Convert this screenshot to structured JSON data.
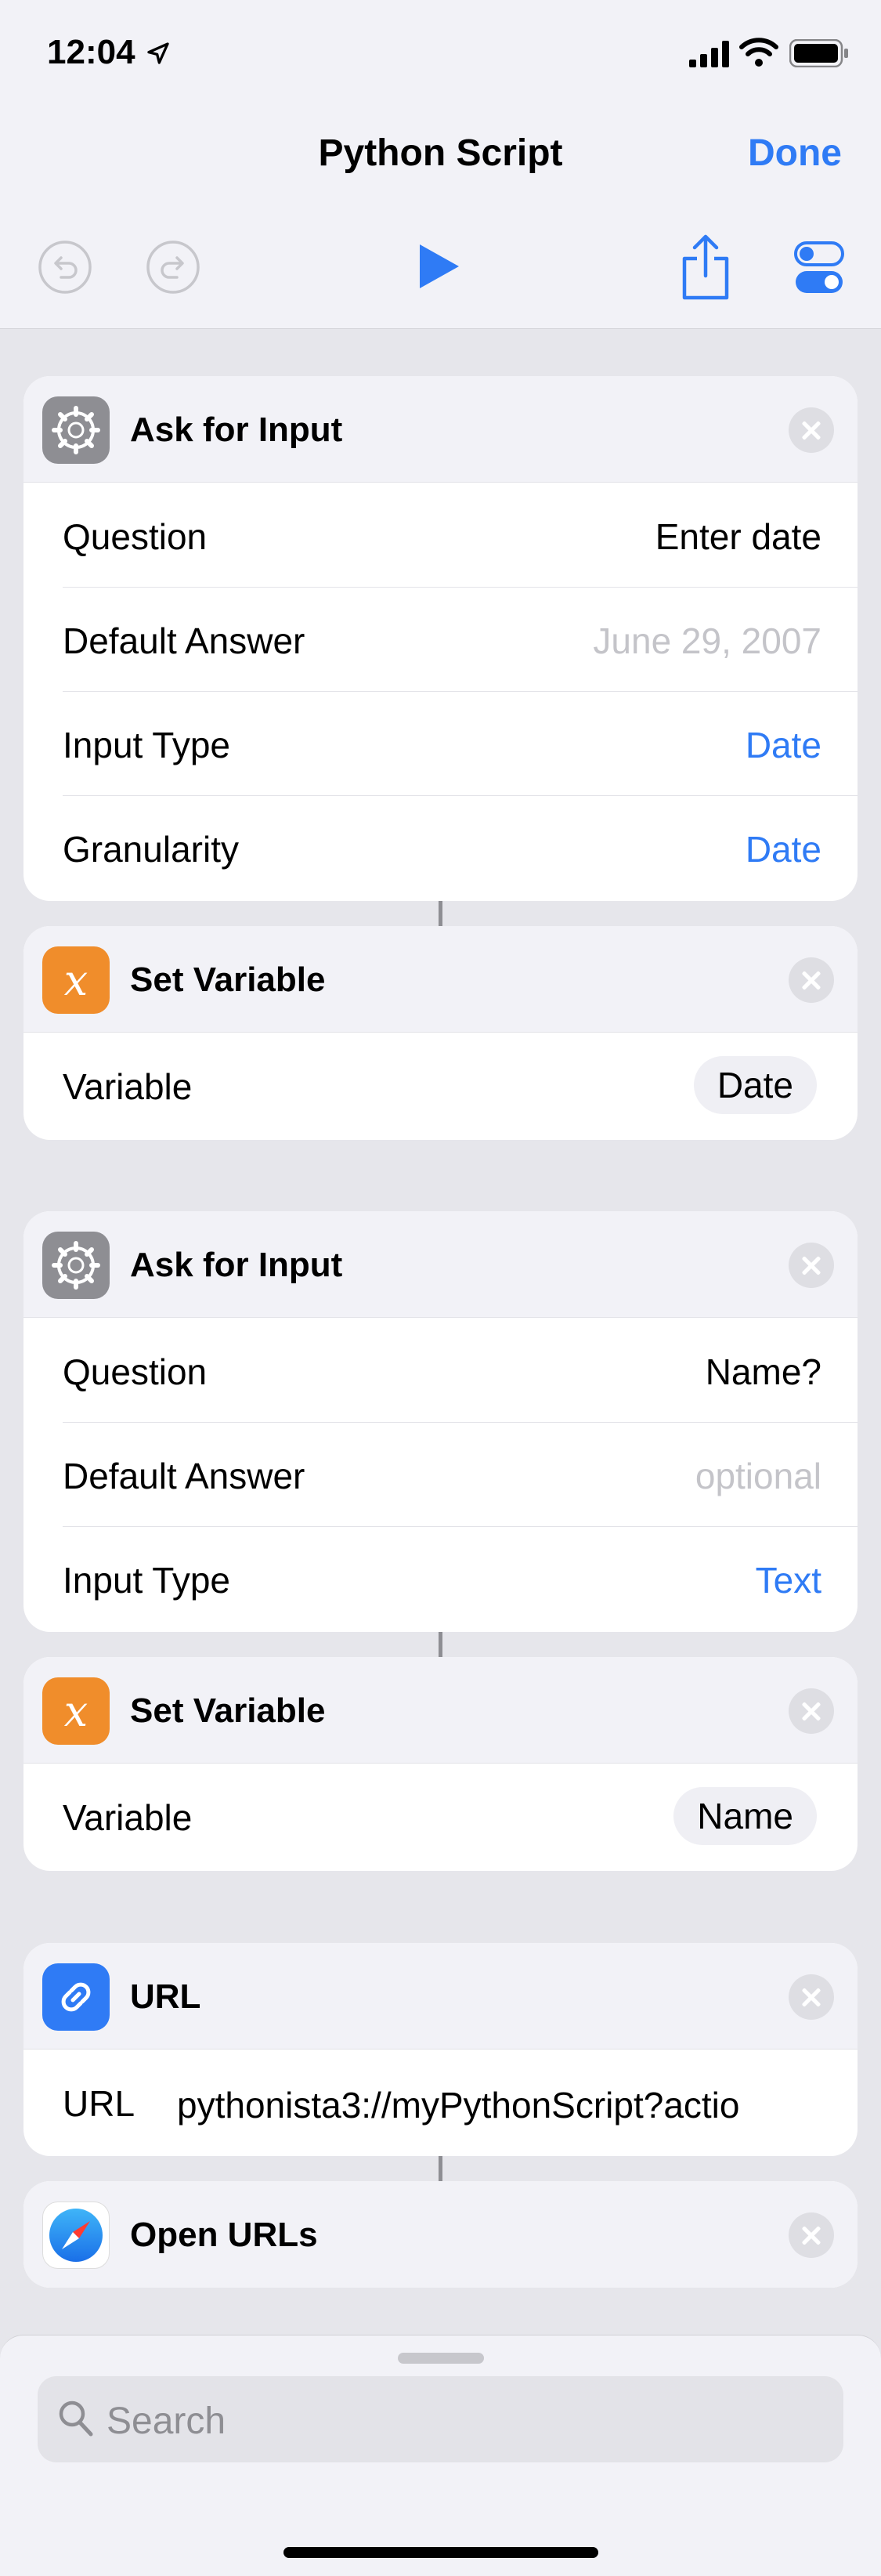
{
  "status_bar": {
    "time": "12:04"
  },
  "nav": {
    "title": "Python Script",
    "done_label": "Done"
  },
  "actions": {
    "ask1": {
      "title": "Ask for Input",
      "rows": [
        {
          "label": "Question",
          "value": "Enter date"
        },
        {
          "label": "Default Answer",
          "value": "June 29, 2007"
        },
        {
          "label": "Input Type",
          "value": "Date"
        },
        {
          "label": "Granularity",
          "value": "Date"
        }
      ]
    },
    "setvar1": {
      "title": "Set Variable",
      "label": "Variable",
      "value": "Date"
    },
    "ask2": {
      "title": "Ask for Input",
      "rows": [
        {
          "label": "Question",
          "value": "Name?"
        },
        {
          "label": "Default Answer",
          "value": "optional"
        },
        {
          "label": "Input Type",
          "value": "Text"
        }
      ]
    },
    "setvar2": {
      "title": "Set Variable",
      "label": "Variable",
      "value": "Name"
    },
    "url": {
      "title": "URL",
      "label": "URL",
      "value": "pythonista3://myPythonScript?actio"
    },
    "open_urls": {
      "title": "Open URLs"
    }
  },
  "search": {
    "placeholder": "Search"
  },
  "colors": {
    "accent": "#2f7bf5",
    "variable_icon": "#f08d2b",
    "gear_icon": "#8e8e93"
  }
}
